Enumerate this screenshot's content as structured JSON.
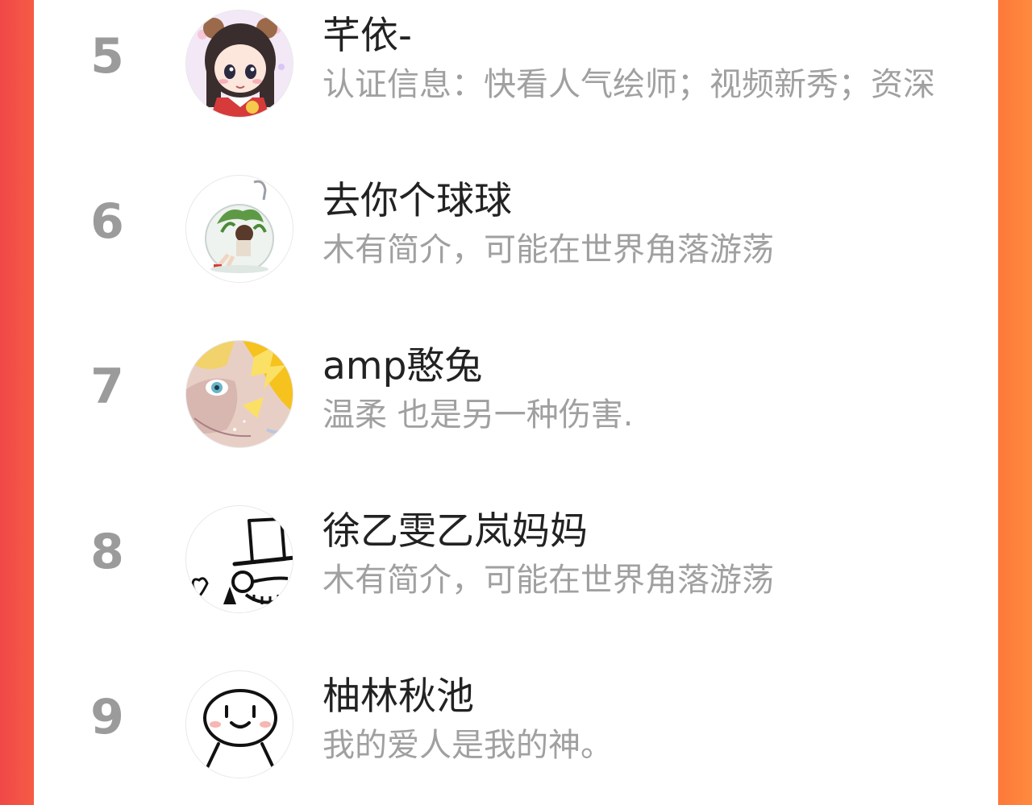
{
  "ranking": {
    "items": [
      {
        "rank": "5",
        "name": "芊依-",
        "bio": "认证信息：快看人气绘师；视频新秀；资深",
        "avatar": "anime-girl-bear-ears-avatar"
      },
      {
        "rank": "6",
        "name": "去你个球球",
        "bio": "木有简介，可能在世界角落游荡",
        "avatar": "girl-in-glass-terrarium-avatar"
      },
      {
        "rank": "7",
        "name": "amp憨兔",
        "bio": "温柔 也是另一种伤害.",
        "avatar": "anime-portrait-yellow-avatar"
      },
      {
        "rank": "8",
        "name": "徐乙雯乙岚妈妈",
        "bio": "木有简介，可能在世界角落游荡",
        "avatar": "top-hat-doodle-avatar"
      },
      {
        "rank": "9",
        "name": "柚林秋池",
        "bio": "我的爱人是我的神。",
        "avatar": "smiley-doodle-avatar"
      }
    ]
  },
  "colors": {
    "background_left": "#f04848",
    "background_right": "#fe8a3e",
    "panel": "#ffffff",
    "rank_text": "#9b9b9b",
    "name_text": "#222222",
    "bio_text": "#a0a0a0"
  }
}
